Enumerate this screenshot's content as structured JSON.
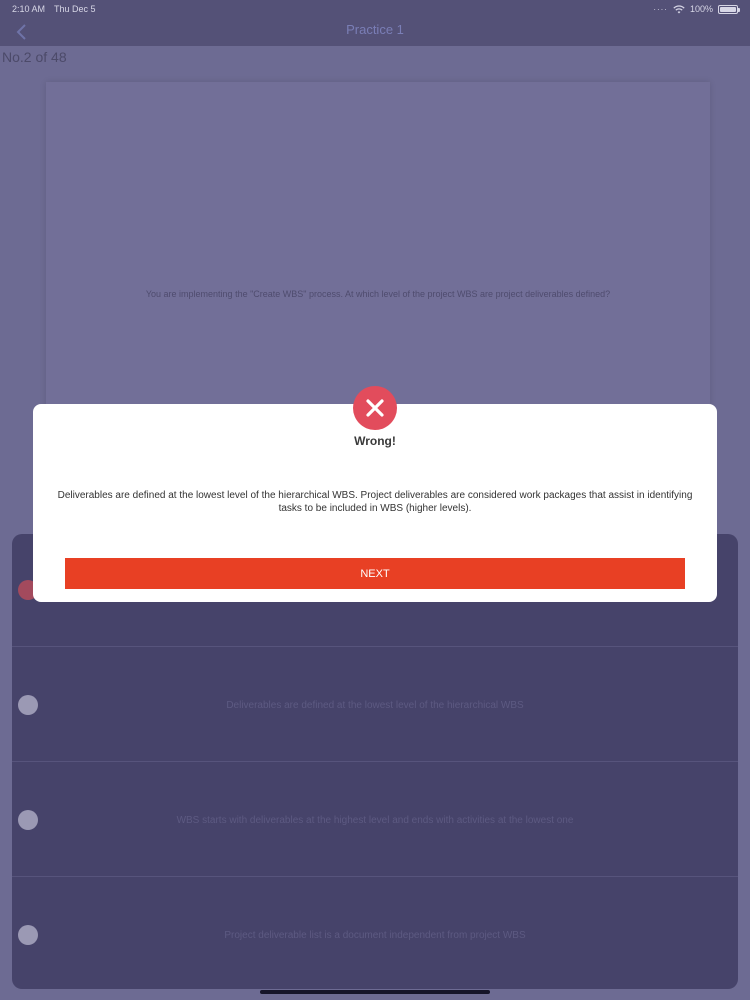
{
  "status_bar": {
    "time": "2:10 AM",
    "date": "Thu Dec 5",
    "battery": "100%",
    "icons": [
      "wifi-icon",
      "battery-icon"
    ]
  },
  "nav": {
    "title": "Practice 1",
    "back_icon": "chevron-left-icon"
  },
  "progress": "No.2 of 48",
  "question": "You are implementing the \"Create WBS\" process. At which level of the project WBS are project deliverables defined?",
  "answers": [
    {
      "text": "",
      "selected": true
    },
    {
      "text": "Deliverables are defined at the lowest level of the hierarchical WBS",
      "selected": false
    },
    {
      "text": "WBS starts with deliverables at the highest level and ends with activities at the lowest one",
      "selected": false
    },
    {
      "text": "Project deliverable list is a document independent from project WBS",
      "selected": false
    }
  ],
  "modal": {
    "icon": "x-icon",
    "title": "Wrong!",
    "body": "Deliverables are defined at the lowest level of the hierarchical WBS. Project deliverables are considered work packages that assist in identifying tasks to be included in WBS (higher levels).",
    "next_label": "NEXT"
  },
  "colors": {
    "accent": "#e84024",
    "error": "#e24c5c",
    "overlay": "#6d6b93",
    "panel": "#46436a"
  }
}
